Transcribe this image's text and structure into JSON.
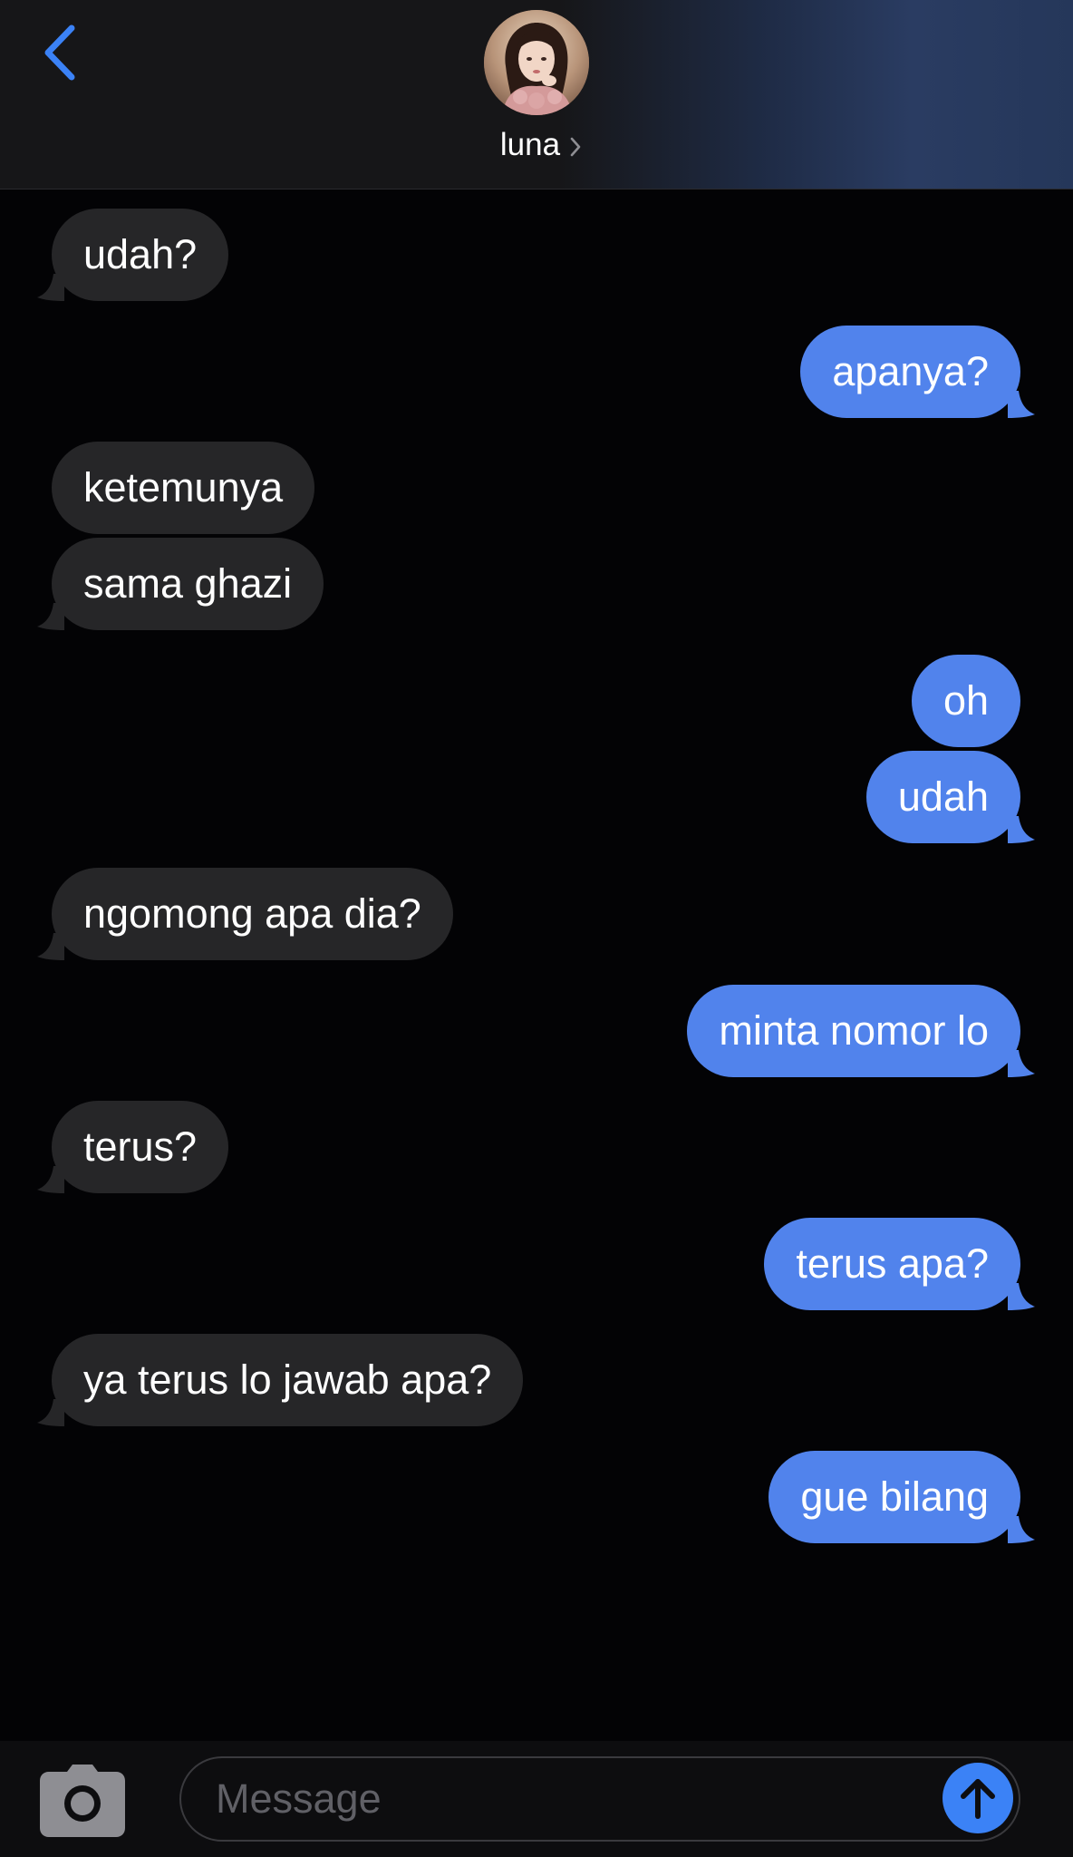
{
  "header": {
    "contact_name": "luna"
  },
  "messages": [
    {
      "side": "in",
      "text": "udah?"
    },
    {
      "side": "out",
      "text": "apanya?"
    },
    {
      "side": "in",
      "text": "ketemunya"
    },
    {
      "side": "in",
      "text": "sama ghazi"
    },
    {
      "side": "out",
      "text": "oh"
    },
    {
      "side": "out",
      "text": "udah"
    },
    {
      "side": "in",
      "text": "ngomong apa dia?"
    },
    {
      "side": "out",
      "text": "minta nomor lo"
    },
    {
      "side": "in",
      "text": "terus?"
    },
    {
      "side": "out",
      "text": "terus apa?"
    },
    {
      "side": "in",
      "text": "ya terus lo jawab apa?"
    },
    {
      "side": "out",
      "text": "gue bilang"
    }
  ],
  "input_bar": {
    "placeholder": "Message",
    "value": ""
  },
  "colors": {
    "incoming_bubble": "#262628",
    "outgoing_bubble": "#5183ec",
    "accent": "#3b82f6",
    "background": "#030305"
  }
}
